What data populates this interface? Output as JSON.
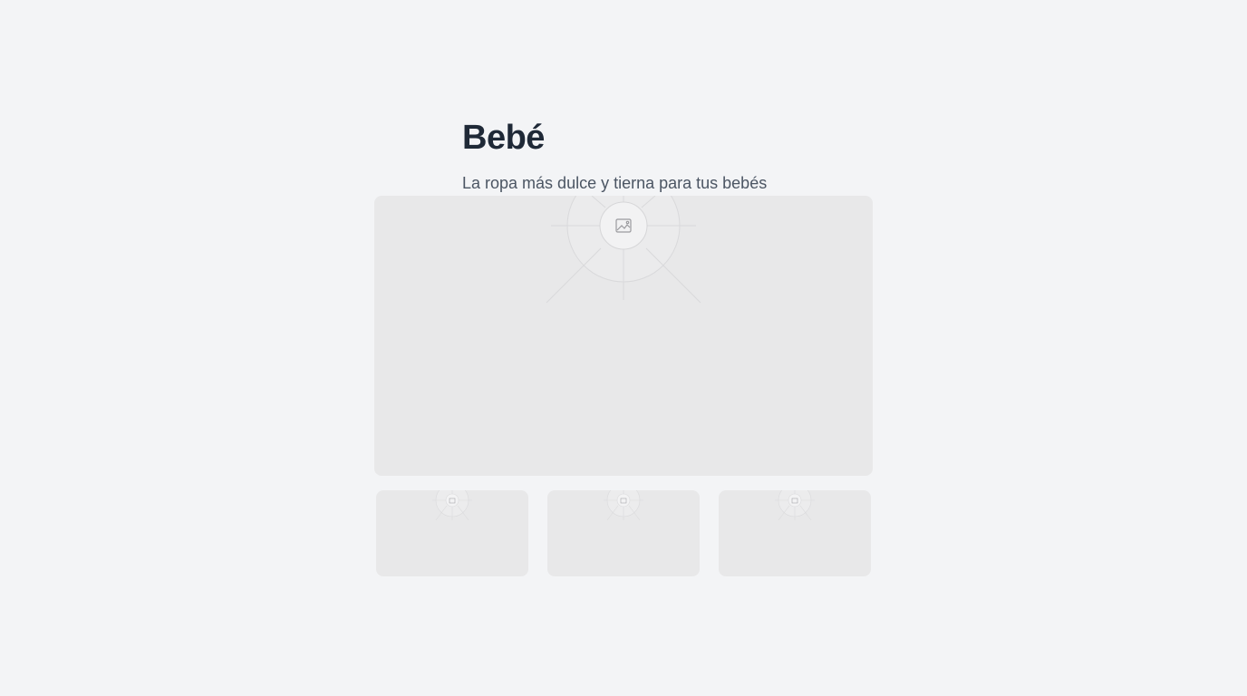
{
  "header": {
    "title": "Bebé",
    "subtitle": "La ropa más dulce y tierna para tus bebés"
  },
  "gallery": {
    "main_image": {
      "icon": "image-placeholder-icon"
    },
    "thumbnails": [
      {
        "icon": "image-placeholder-icon"
      },
      {
        "icon": "image-placeholder-icon"
      },
      {
        "icon": "image-placeholder-icon"
      }
    ]
  },
  "colors": {
    "background": "#f3f4f6",
    "title": "#1f2937",
    "subtitle": "#4b5563",
    "placeholder": "#e8e8e9"
  }
}
